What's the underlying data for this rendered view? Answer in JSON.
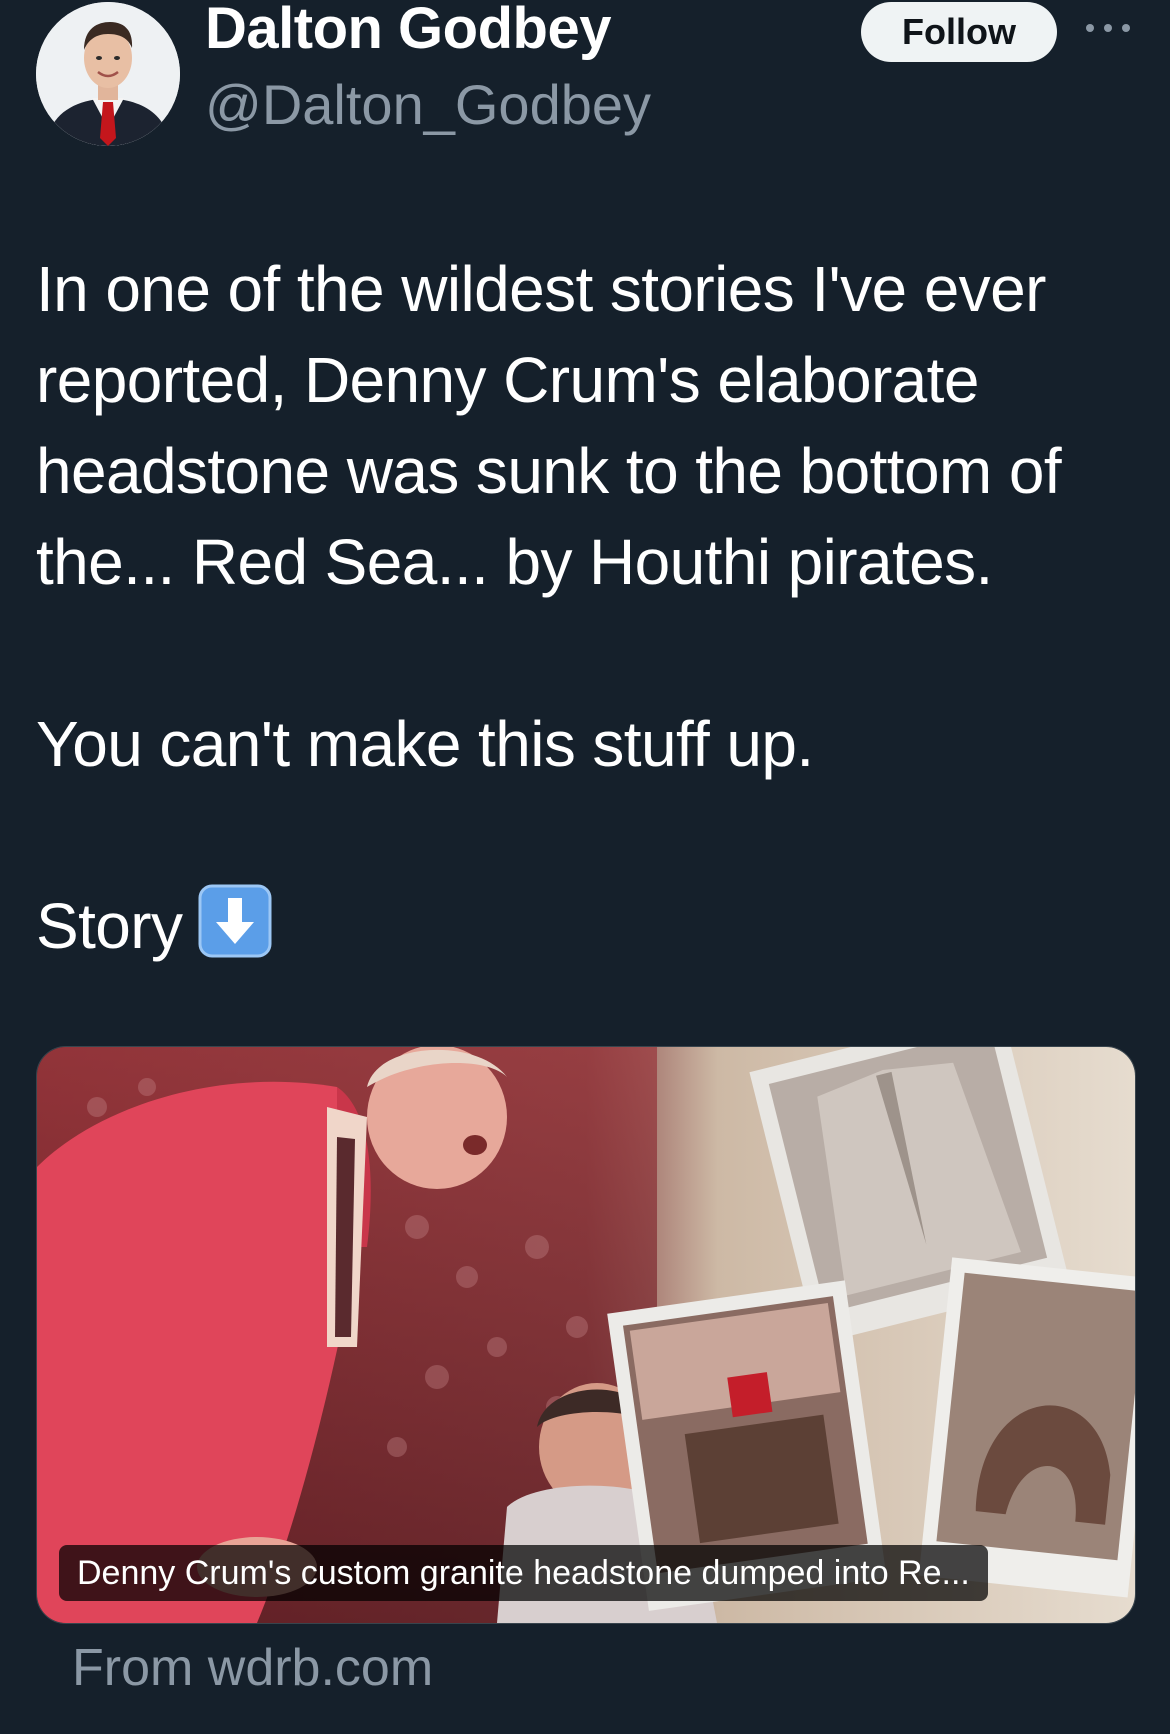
{
  "author": {
    "display_name": "Dalton Godbey",
    "handle": "@Dalton_Godbey"
  },
  "header": {
    "follow_label": "Follow",
    "more_icon": "more-horizontal-icon"
  },
  "tweet": {
    "paragraph_1": "In one of the wildest stories I've ever reported, Denny Crum's elaborate headstone was sunk to the bottom of the... Red Sea... by Houthi pirates.",
    "paragraph_2": "You can't make this stuff up.",
    "paragraph_3": "Story",
    "emoji": "down-arrow-icon"
  },
  "card": {
    "caption": "Denny Crum's custom granite headstone dumped into Re...",
    "source": "From wdrb.com"
  },
  "colors": {
    "background": "#15202b",
    "follow_bg": "#eff3f4",
    "secondary_text": "#8b98a5"
  }
}
